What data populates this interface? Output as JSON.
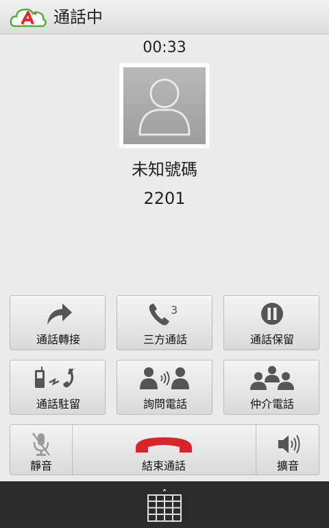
{
  "header": {
    "title": "通話中",
    "app_icon": "cloud-a-logo"
  },
  "call": {
    "duration": "00:33",
    "caller_name": "未知號碼",
    "caller_number": "2201"
  },
  "actions": [
    {
      "label": "通話轉接",
      "icon": "transfer-arrow-icon"
    },
    {
      "label": "三方通話",
      "icon": "three-way-call-icon",
      "badge": "3"
    },
    {
      "label": "通話保留",
      "icon": "pause-icon"
    },
    {
      "label": "通話駐留",
      "icon": "call-park-icon"
    },
    {
      "label": "詢問電話",
      "icon": "consult-call-icon"
    },
    {
      "label": "仲介電話",
      "icon": "conference-call-icon"
    }
  ],
  "callbar": {
    "mute_label": "靜音",
    "end_label": "結束通話",
    "speaker_label": "擴音"
  },
  "colors": {
    "end_call_red": "#d8232a",
    "app_red": "#e8262b",
    "app_green": "#4fae3a",
    "icon_gray": "#555555"
  },
  "navbar": {
    "keypad_icon": "dialpad-icon"
  }
}
